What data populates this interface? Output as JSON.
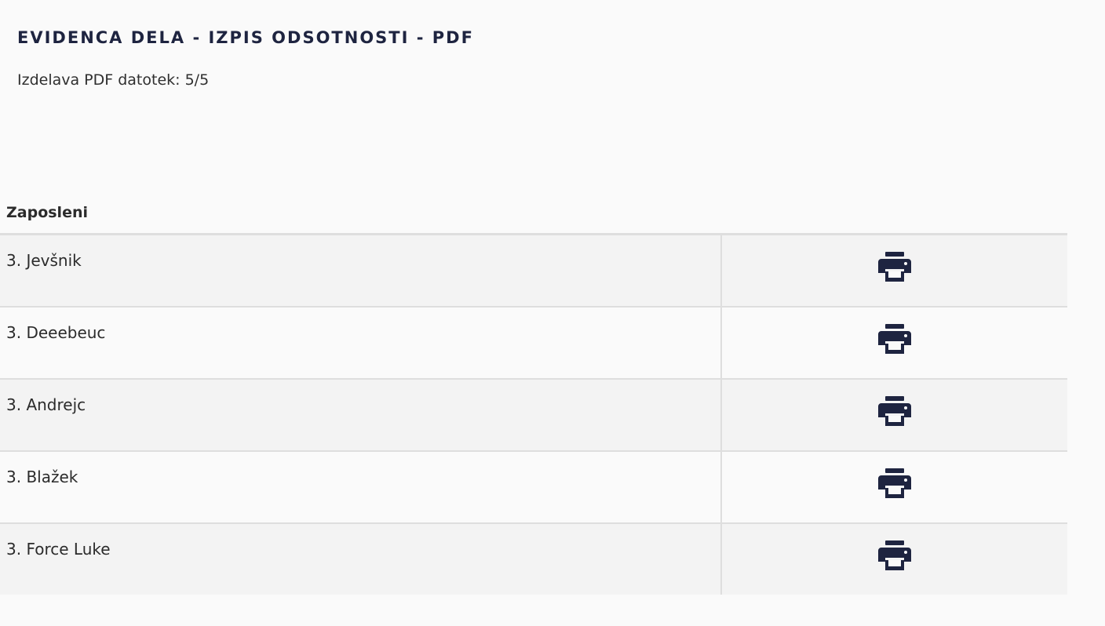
{
  "header": {
    "title": "EVIDENCA DELA - IZPIS ODSOTNOSTI - PDF",
    "progress_text": "Izdelava PDF datotek: 5/5"
  },
  "table": {
    "column_header": "Zaposleni",
    "rows": [
      {
        "name": "3. Jevšnik",
        "action_icon": "print-icon"
      },
      {
        "name": "3. Deeebeuc",
        "action_icon": "print-icon"
      },
      {
        "name": "3. Andrejc",
        "action_icon": "print-icon"
      },
      {
        "name": "3. Blažek",
        "action_icon": "print-icon"
      },
      {
        "name": "3. Force Luke",
        "action_icon": "print-icon"
      }
    ]
  },
  "colors": {
    "title": "#1e2440",
    "icon": "#1e2440",
    "row_stripe": "#f3f3f3",
    "background": "#fafafa",
    "border": "#dedede"
  }
}
